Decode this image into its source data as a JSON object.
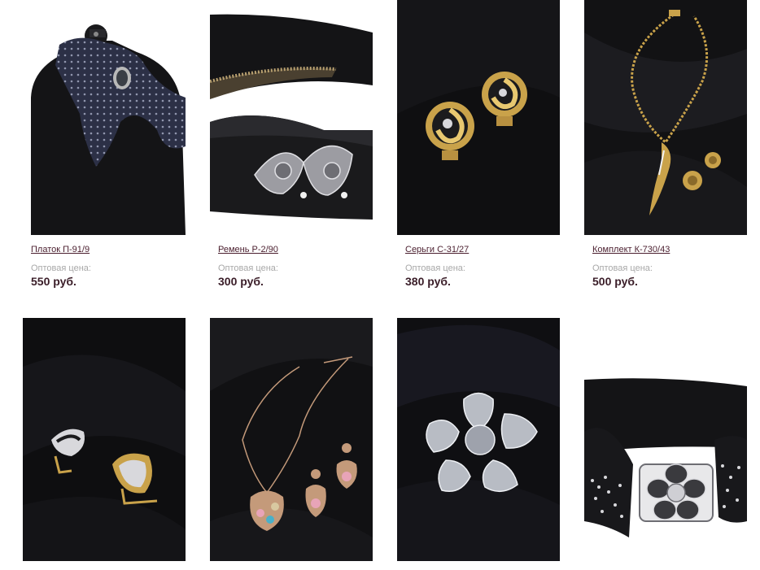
{
  "products": [
    {
      "name": "Платок П-91/9",
      "price_label": "Оптовая цена:",
      "price": "550 руб.",
      "image": "scarf-on-mannequin"
    },
    {
      "name": "Ремень Р-2/90",
      "price_label": "Оптовая цена:",
      "price": "300 руб.",
      "image": "black-belt-silver-buckle"
    },
    {
      "name": "Серьги С-31/27",
      "price_label": "Оптовая цена:",
      "price": "380 руб.",
      "image": "gold-swirl-earrings"
    },
    {
      "name": "Комплект К-730/43",
      "price_label": "Оптовая цена:",
      "price": "500 руб.",
      "image": "gold-necklace-set"
    }
  ],
  "row2_images": [
    {
      "image": "gold-crystal-earrings"
    },
    {
      "image": "rose-gold-necklace-set"
    },
    {
      "image": "crystal-flower-brooch"
    },
    {
      "image": "black-belt-flower-buckle"
    }
  ],
  "colors": {
    "link": "#4a1e2e",
    "label": "#a8a8a8",
    "price": "#3a1d28",
    "photo_bg": "#0c0c0e"
  }
}
